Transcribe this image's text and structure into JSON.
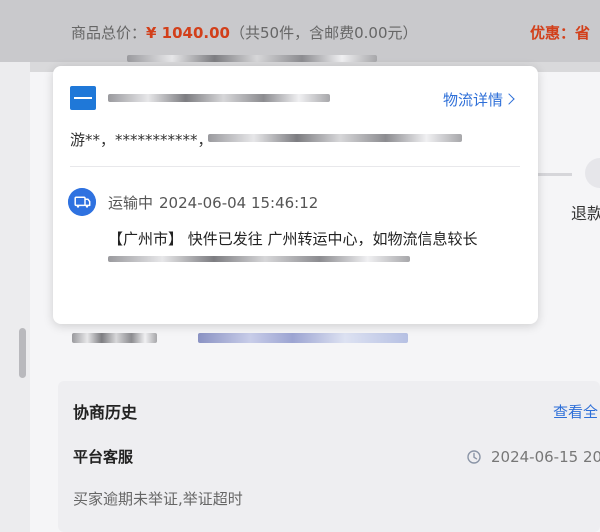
{
  "order_bar": {
    "total_label": "商品总价：",
    "total_amount": "¥ 1040.00",
    "total_note": "（共50件，含邮费0.00元）",
    "discount_text": "优惠：省"
  },
  "timeline": {
    "refund_text": "退款"
  },
  "logistics_popup": {
    "detail_link": "物流详情",
    "recipient_prefix": "游**，***********，",
    "status": "运输中",
    "status_time": "2024-06-04 15:46:12",
    "message": "【广州市】 快件已发往 广州转运中心，如物流信息较长"
  },
  "history": {
    "title": "协商历史",
    "view_all": "查看全",
    "entries": [
      {
        "role": "平台客服",
        "time": "2024-06-15 20:",
        "note": "买家逾期未举证,举证超时"
      }
    ]
  },
  "icons": {
    "carrier_logo": "carrier-logo",
    "truck": "truck-icon",
    "clock": "clock-icon",
    "chevron": "chevron-right-icon"
  },
  "colors": {
    "accent_red": "#d23f1a",
    "link_blue": "#2e6fd8"
  }
}
